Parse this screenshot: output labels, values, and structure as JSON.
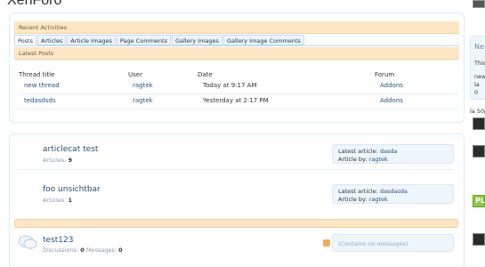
{
  "site": {
    "title": "XenForo"
  },
  "recent_activities": {
    "header": "Recent Activities",
    "tabs": [
      {
        "label": "Posts",
        "active": true
      },
      {
        "label": "Articles",
        "active": false
      },
      {
        "label": "Article Images",
        "active": false
      },
      {
        "label": "Page Comments",
        "active": false
      },
      {
        "label": "Gallery Images",
        "active": false
      },
      {
        "label": "Gallery Image Comments",
        "active": false
      }
    ],
    "section": "Latest Posts",
    "columns": [
      "Thread title",
      "User",
      "Date",
      "Forum"
    ],
    "rows": [
      {
        "title": "new thread",
        "user": "ragtek",
        "date": "Today at 9:17 AM",
        "forum": "Addons"
      },
      {
        "title": "tedasdsds",
        "user": "ragtek",
        "date": "Yesterday at 2:17 PM",
        "forum": "Addons"
      }
    ]
  },
  "categories": [
    {
      "title": "articlecat test",
      "stat_label": "Articles:",
      "stat_value": "9",
      "latest_label": "Latest article:",
      "latest_value": "dasda",
      "by_label": "Article by:",
      "by_value": "ragtek"
    },
    {
      "title": "foo unsichtbar",
      "stat_label": "Articles:",
      "stat_value": "1",
      "latest_label": "Latest article:",
      "latest_value": "dasdasda",
      "by_label": "Article by:",
      "by_value": "ragtek"
    }
  ],
  "forum": {
    "title": "test123",
    "discussions_label": "Discussions:",
    "discussions_value": "0",
    "messages_label": "Messages:",
    "messages_value": "0",
    "empty_text": "(Contains no messages)"
  },
  "sidebar": {
    "heading": "Ne",
    "line1": "This",
    "line2": "new",
    "line3": "la",
    "line4": "0",
    "caption": "la 50p",
    "badge": "PL"
  },
  "colors": {
    "accent": "#2b4f7e",
    "header_bg": "#fbe7c4",
    "panel_border": "#d7edfc"
  },
  "icons": {
    "forum": "speech-bubble-icon",
    "feed": "rss-icon"
  }
}
